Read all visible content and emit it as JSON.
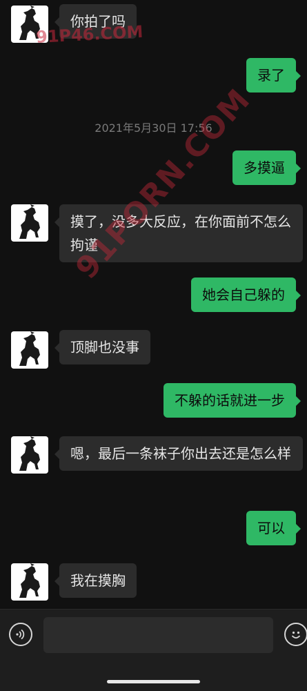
{
  "conversation": {
    "timestamp": "2021年5月30日 17:56",
    "messages": [
      {
        "side": "in",
        "text": "你拍了吗",
        "avatar": "horse-icon"
      },
      {
        "side": "out",
        "text": "录了"
      },
      {
        "side": "out",
        "text": "多摸逼"
      },
      {
        "side": "in",
        "text": "摸了，没多大反应，在你面前不怎么拘谨",
        "avatar": "horse-icon"
      },
      {
        "side": "out",
        "text": "她会自己躲的"
      },
      {
        "side": "in",
        "text": "顶脚也没事",
        "avatar": "horse-icon"
      },
      {
        "side": "out",
        "text": "不躲的话就进一步"
      },
      {
        "side": "in",
        "text": "嗯，最后一条袜子你出去还是怎么样",
        "avatar": "horse-icon"
      },
      {
        "side": "out",
        "text": "可以"
      },
      {
        "side": "in",
        "text": "我在摸胸",
        "avatar": "horse-icon"
      }
    ]
  },
  "watermarks": {
    "top": "91P46.COM",
    "diagonal": "91PORN.COM"
  },
  "input_bar": {
    "value": "",
    "placeholder": "",
    "voice_icon": "voice-icon",
    "emoji_icon": "emoji-icon"
  },
  "colors": {
    "background": "#111111",
    "incoming_bubble": "#2c2c2c",
    "outgoing_bubble": "#2fb865",
    "timestamp_text": "#7a7a7a",
    "watermark": "#c8283c"
  }
}
